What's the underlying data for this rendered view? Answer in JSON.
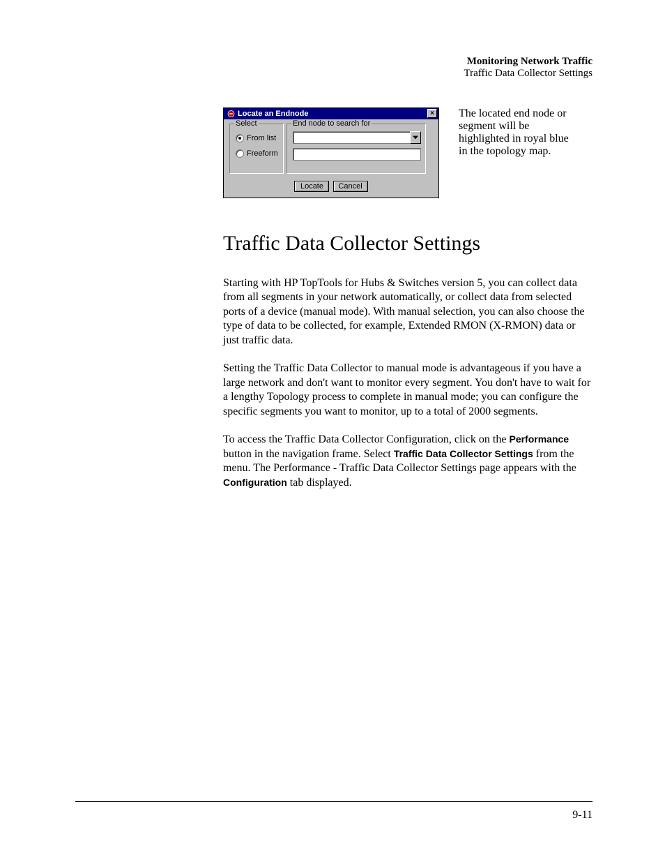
{
  "header": {
    "line1": "Monitoring Network Traffic",
    "line2": "Traffic Data Collector Settings"
  },
  "dialog": {
    "title": "Locate an Endnode",
    "close_glyph": "✕",
    "select_legend": "Select",
    "radio_from_list": "From list",
    "radio_freeform": "Freeform",
    "search_legend": "End node to search for",
    "locate_label": "Locate",
    "cancel_label": "Cancel"
  },
  "caption": "The located end node or segment will be highlighted in royal blue in the topology map.",
  "section_heading": "Traffic Data Collector Settings",
  "para1": "Starting with HP TopTools for Hubs & Switches version 5, you can collect data from all segments in your network automatically, or collect data from selected ports of a device (manual mode). With manual selection, you can also choose the type of data to be collected, for example, Extended RMON (X-RMON) data or just traffic data.",
  "para2": "Setting the Traffic Data Collector to manual mode is advantageous if you have a large network and don't want to monitor every segment. You don't have to wait for a lengthy Topology process to complete in manual mode; you can configure the specific segments you want to monitor, up to a total of 2000 segments.",
  "para3": {
    "t1": "To access the Traffic Data Collector Configuration, click on the ",
    "b1": "Performance",
    "t2": " button in the navigation frame. Select ",
    "b2": "Traffic Data Collector Settings",
    "t3": " from the menu. The Performance - Traffic Data Collector Settings page appears with the ",
    "b3": "Configuration",
    "t4": " tab displayed."
  },
  "page_number": "9-11"
}
